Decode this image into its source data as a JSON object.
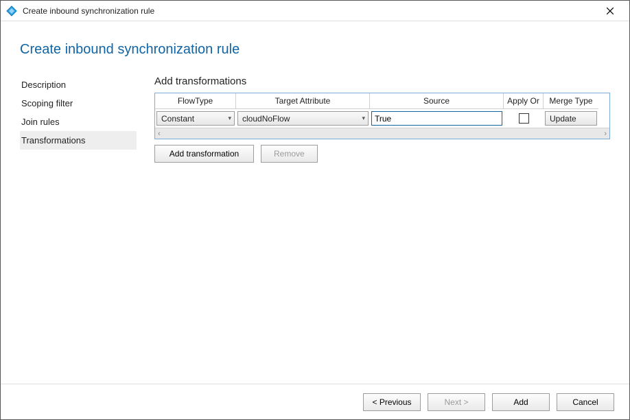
{
  "window": {
    "title": "Create inbound synchronization rule"
  },
  "heading": "Create inbound synchronization rule",
  "sidebar": {
    "items": [
      {
        "label": "Description",
        "active": false
      },
      {
        "label": "Scoping filter",
        "active": false
      },
      {
        "label": "Join rules",
        "active": false
      },
      {
        "label": "Transformations",
        "active": true
      }
    ]
  },
  "panel": {
    "title": "Add transformations",
    "columns": {
      "flowtype": "FlowType",
      "target": "Target Attribute",
      "source": "Source",
      "apply": "Apply Or",
      "merge": "Merge Type"
    },
    "row": {
      "flowtype": "Constant",
      "target": "cloudNoFlow",
      "source": "True",
      "apply_once": false,
      "merge": "Update"
    },
    "buttons": {
      "add_transformation": "Add transformation",
      "remove": "Remove"
    }
  },
  "footer": {
    "previous": "< Previous",
    "next": "Next >",
    "add": "Add",
    "cancel": "Cancel"
  }
}
